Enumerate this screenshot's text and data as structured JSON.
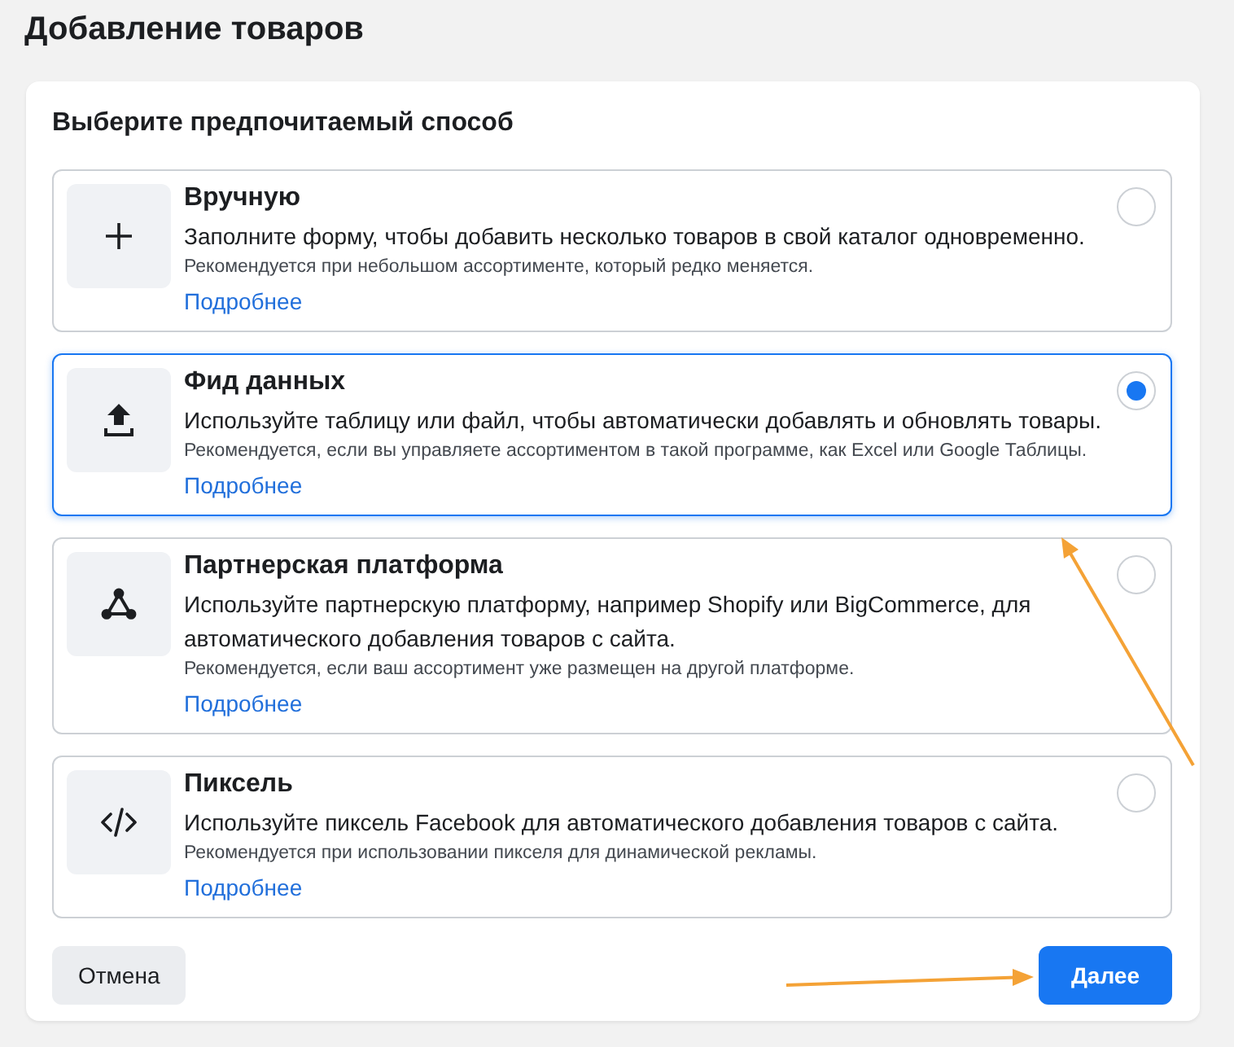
{
  "page": {
    "title": "Добавление товаров"
  },
  "card": {
    "heading": "Выберите предпочитаемый способ",
    "options": [
      {
        "kind": "plus",
        "title": "Вручную",
        "description": "Заполните форму, чтобы добавить несколько товаров в свой каталог одновременно.",
        "recommendation": "Рекомендуется при небольшом ассортименте, который редко меняется.",
        "link": "Подробнее",
        "selected": false
      },
      {
        "kind": "upload",
        "title": "Фид данных",
        "description": "Используйте таблицу или файл, чтобы автоматически добавлять и обновлять товары.",
        "recommendation": "Рекомендуется, если вы управляете ассортиментом в такой программе, как Excel или Google Таблицы.",
        "link": "Подробнее",
        "selected": true
      },
      {
        "kind": "network",
        "title": "Партнерская платформа",
        "description": "Используйте партнерскую платформу, например Shopify или BigCommerce, для автоматического добавления товаров с сайта.",
        "recommendation": "Рекомендуется, если ваш ассортимент уже размещен на другой платформе.",
        "link": "Подробнее",
        "selected": false
      },
      {
        "kind": "code",
        "title": "Пиксель",
        "description": "Используйте пиксель Facebook для автоматического добавления товаров с сайта.",
        "recommendation": "Рекомендуется при использовании пикселя для динамической рекламы.",
        "link": "Подробнее",
        "selected": false
      }
    ]
  },
  "buttons": [
    {
      "kind": "secondary",
      "label": "Отмена"
    },
    {
      "kind": "primary",
      "label": "Далее"
    }
  ]
}
